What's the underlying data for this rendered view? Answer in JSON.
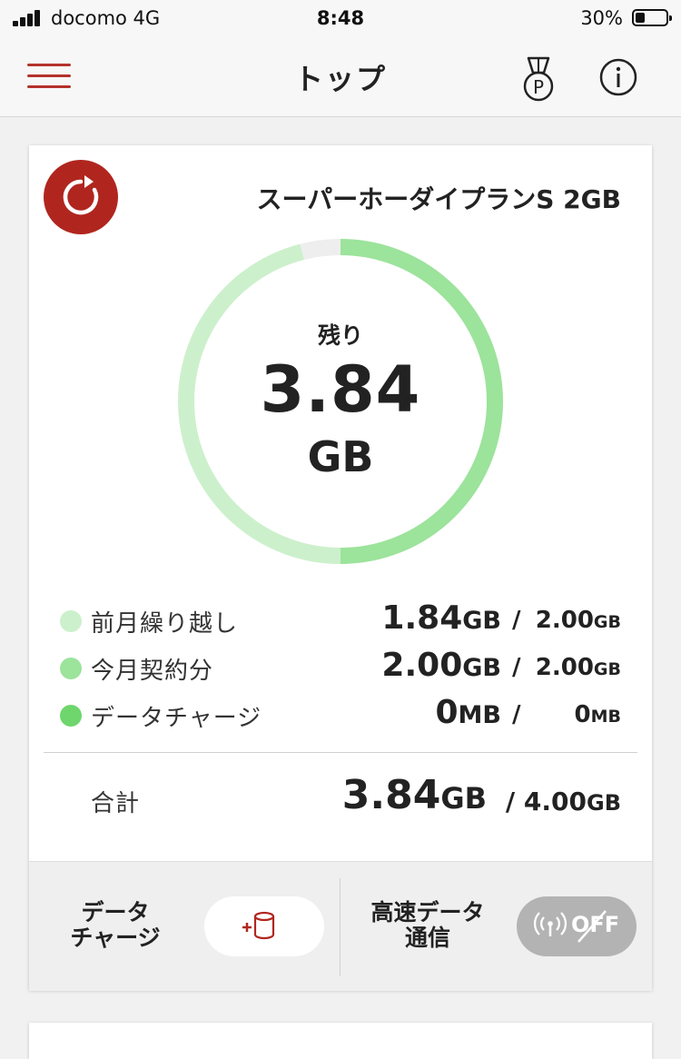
{
  "status_bar": {
    "carrier": "docomo   4G",
    "time": "8:48",
    "battery_percent": "30%",
    "battery_level": 0.3
  },
  "nav": {
    "title": "トップ",
    "accent_color": "#b5322c"
  },
  "plan": {
    "name": "スーパーホーダイプランS 2GB"
  },
  "gauge": {
    "label": "残り",
    "value": "3.84",
    "unit": "GB",
    "segments": [
      {
        "name": "今月契約分",
        "gb": 2.0,
        "color": "#9ce39b"
      },
      {
        "name": "前月繰り越し",
        "gb": 1.84,
        "color": "#ccf0cc"
      },
      {
        "name": "empty",
        "gb": 0.16,
        "color": "#eeeeee"
      }
    ],
    "total_gb": 4.0
  },
  "breakdown": [
    {
      "label": "前月繰り越し",
      "used": "1.84",
      "used_unit": "GB",
      "limit": "2.00",
      "limit_unit": "GB",
      "color": "#ccf0cc"
    },
    {
      "label": "今月契約分",
      "used": "2.00",
      "used_unit": "GB",
      "limit": "2.00",
      "limit_unit": "GB",
      "color": "#9ce39b"
    },
    {
      "label": "データチャージ",
      "used": "0",
      "used_unit": "MB",
      "limit": "0",
      "limit_unit": "MB",
      "color": "#6ed66c"
    }
  ],
  "total": {
    "label": "合計",
    "used": "3.84",
    "used_unit": "GB",
    "limit": "4.00",
    "limit_unit": "GB"
  },
  "actions": {
    "charge_label_line1": "データ",
    "charge_label_line2": "チャージ",
    "highspeed_label_line1": "高速データ",
    "highspeed_label_line2": "通信",
    "highspeed_state": "OFF"
  },
  "icons": [
    "signal-icon",
    "battery-icon",
    "hamburger-menu-icon",
    "medal-points-icon",
    "info-icon",
    "refresh-icon",
    "add-data-icon",
    "antenna-icon"
  ]
}
